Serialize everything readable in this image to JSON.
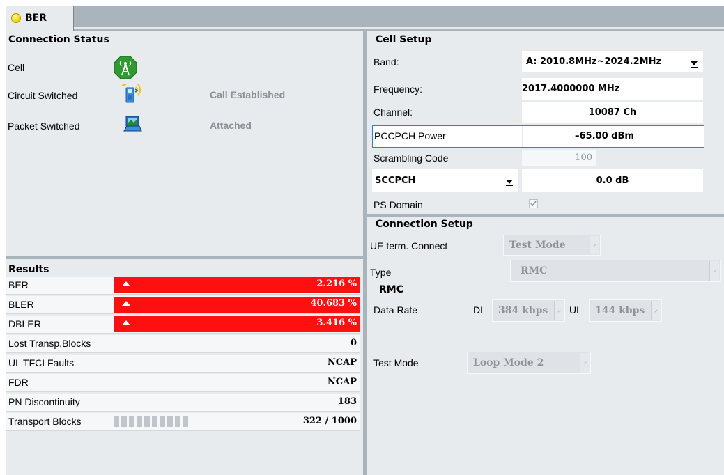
{
  "tab": {
    "label": "BER"
  },
  "connection_status": {
    "title": "Connection Status",
    "items": [
      {
        "label": "Cell",
        "icon": "cell-tower-icon",
        "status": ""
      },
      {
        "label": "Circuit Switched",
        "icon": "phone-icon",
        "status": "Call Established"
      },
      {
        "label": "Packet Switched",
        "icon": "laptop-icon",
        "status": "Attached"
      }
    ]
  },
  "results": {
    "title": "Results",
    "rows": [
      {
        "label": "BER",
        "value": "2.216 %",
        "alarm": true
      },
      {
        "label": "BLER",
        "value": "40.683 %",
        "alarm": true
      },
      {
        "label": "DBLER",
        "value": "3.416 %",
        "alarm": true
      },
      {
        "label": "Lost Transp.Blocks",
        "value": "0"
      },
      {
        "label": "UL TFCI Faults",
        "value": "NCAP"
      },
      {
        "label": "FDR",
        "value": "NCAP"
      },
      {
        "label": "PN Discontinuity",
        "value": "183"
      },
      {
        "label": "Transport Blocks",
        "value": "322 / 1000",
        "progress": 0.322
      }
    ],
    "alarm_color": "#ff1010"
  },
  "cell_setup": {
    "title": "Cell Setup",
    "band_label": "Band:",
    "band_value": "A: 2010.8MHz~2024.2MHz",
    "frequency_label": "Frequency:",
    "frequency_value": "2017.4000000 MHz",
    "channel_label": "Channel:",
    "channel_value": "10087 Ch",
    "pccpch_label": "PCCPCH Power",
    "pccpch_value": "–65.00 dBm",
    "scrambling_label": "Scrambling Code",
    "scrambling_value": "100",
    "sccpch_select": "SCCPCH",
    "sccpch_value": "0.0 dB",
    "ps_domain_label": "PS Domain",
    "ps_domain_checked": true
  },
  "connection_setup": {
    "title": "Connection Setup",
    "ue_term_label": "UE term. Connect",
    "ue_term_value": "Test Mode",
    "type_label": "Type",
    "type_value": "RMC",
    "rmc_title": "RMC",
    "data_rate_label": "Data Rate",
    "dl_label": "DL",
    "dl_value": "384 kbps",
    "ul_label": "UL",
    "ul_value": "144 kbps",
    "test_mode_label": "Test Mode",
    "test_mode_value": "Loop Mode 2"
  }
}
